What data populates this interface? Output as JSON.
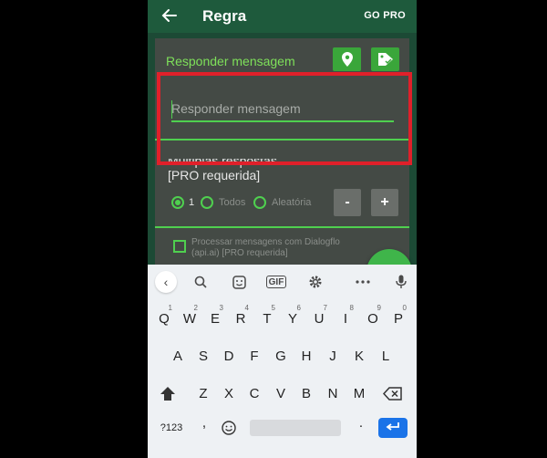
{
  "appbar": {
    "title": "Regra",
    "go_pro": "GO PRO"
  },
  "card": {
    "title": "Responder mensagem",
    "input_placeholder": "Responder mensagem",
    "multi_line1": "Múltiplas respostas",
    "multi_line2": "[PRO requerida]",
    "radios": [
      "1",
      "Todos",
      "Aleatória"
    ],
    "selected_radio": "1",
    "minus": "-",
    "plus": "+",
    "dialogflow_line1": "Processar mensagens com Dialogflo",
    "dialogflow_line2": "(api.ai) [PRO requerida]"
  },
  "keyboard": {
    "gif": "GIF",
    "row1": [
      "Q",
      "W",
      "E",
      "R",
      "T",
      "Y",
      "U",
      "I",
      "O",
      "P"
    ],
    "row1_nums": [
      "1",
      "2",
      "3",
      "4",
      "5",
      "6",
      "7",
      "8",
      "9",
      "0"
    ],
    "row2": [
      "A",
      "S",
      "D",
      "F",
      "G",
      "H",
      "J",
      "K",
      "L"
    ],
    "row3": [
      "Z",
      "X",
      "C",
      "V",
      "B",
      "N",
      "M"
    ],
    "sym": "?123",
    "comma": ",",
    "period": "."
  },
  "colors": {
    "accent": "#4fd04f",
    "highlight": "#e0202a",
    "enter": "#1a73e8"
  }
}
